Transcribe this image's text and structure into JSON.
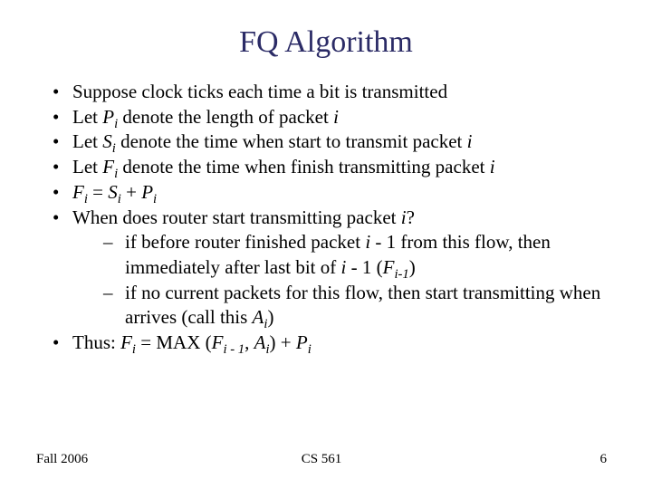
{
  "title": "FQ Algorithm",
  "b1_a": "Suppose clock ticks each time a bit is transmitted",
  "b2_a": "Let ",
  "b2_b": " denote the length of packet ",
  "b3_a": "Let ",
  "b3_b": " denote the time when start to transmit packet ",
  "b4_a": "Let ",
  "b4_b": " denote the time when finish transmitting packet ",
  "b5_eq_a": " = ",
  "b5_eq_b": " + ",
  "b6_a": "When does router start transmitting packet ",
  "b6_b": "?",
  "s1_a": "if before router finished packet ",
  "s1_b": " - 1 from this flow, then immediately after last bit of ",
  "s1_c": " - 1 (",
  "s1_d": ")",
  "s2_a": "if no current packets for this flow, then start transmitting when arrives (call this ",
  "s2_b": ")",
  "b7_a": "Thus: ",
  "b7_b": " = MAX (",
  "b7_c": ", ",
  "b7_d": ") + ",
  "sym_P": "P",
  "sym_S": "S",
  "sym_F": "F",
  "sym_A": "A",
  "sub_i": "i",
  "sub_im1": "i-1",
  "sub_i_sp_m1": "i - 1",
  "var_i": "i",
  "footer_left": "Fall 2006",
  "footer_center": "CS 561",
  "footer_right": "6"
}
